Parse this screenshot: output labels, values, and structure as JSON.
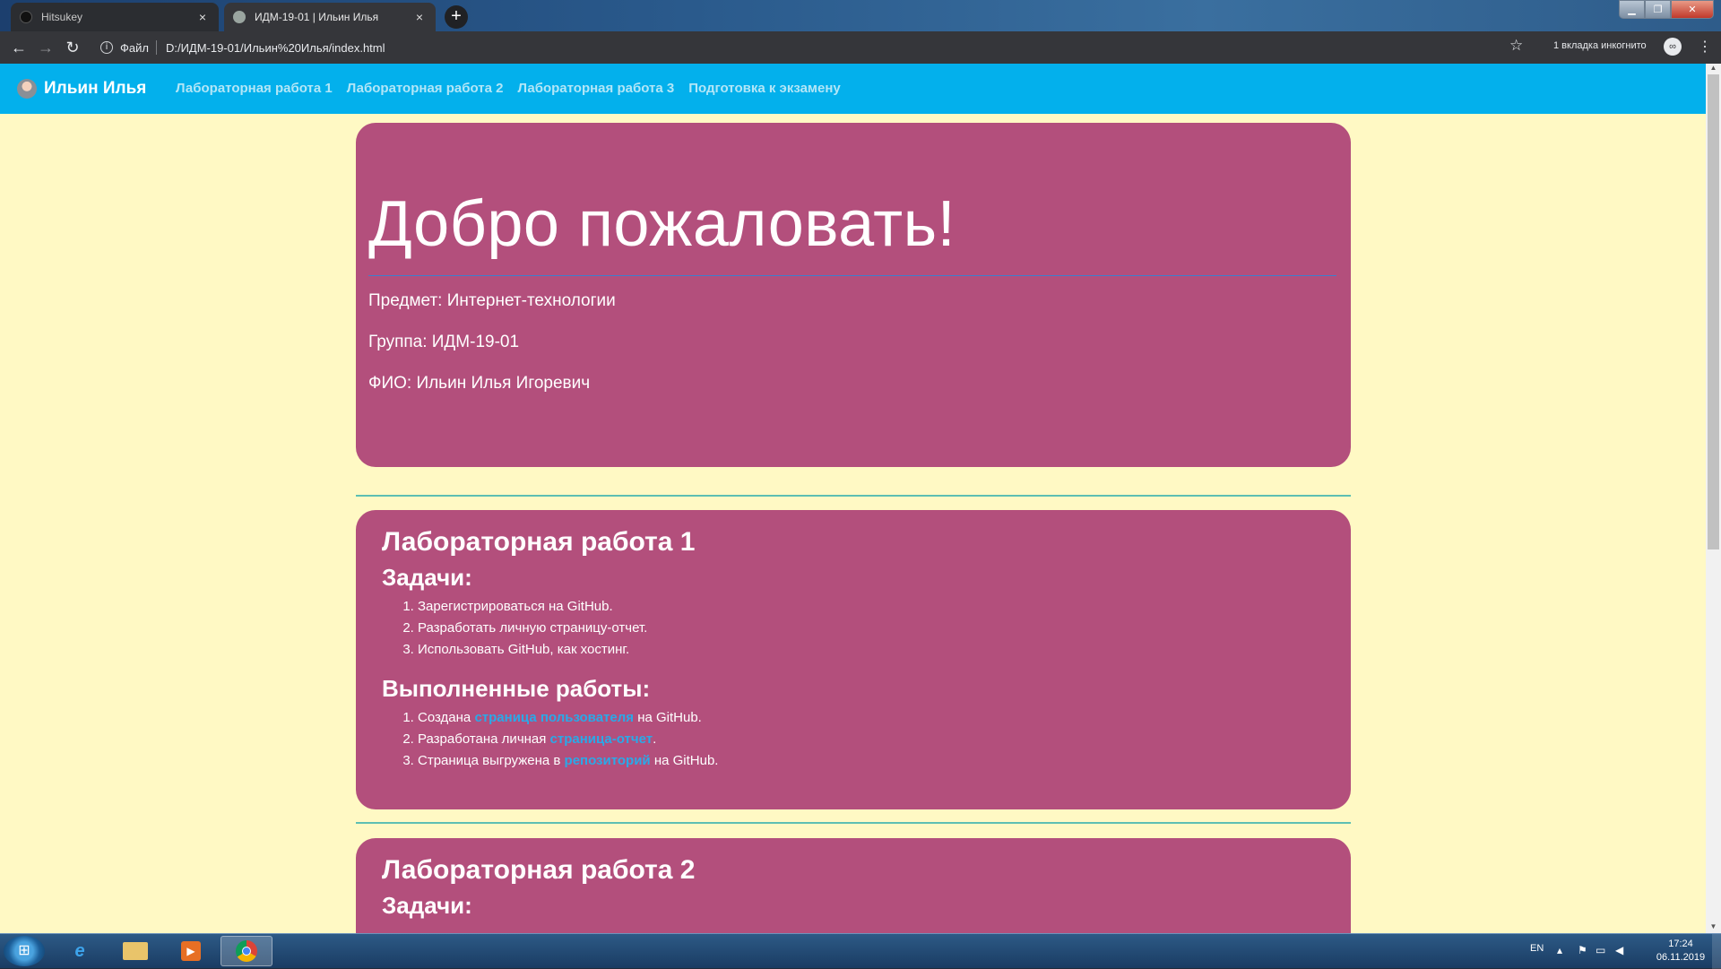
{
  "browser": {
    "tabs": [
      {
        "title": "Hitsukey",
        "active": false,
        "close": "×"
      },
      {
        "title": "ИДМ-19-01 | Ильин Илья",
        "active": true,
        "close": "×"
      }
    ],
    "new_tab": "+",
    "address": {
      "scheme": "Файл",
      "url": "D:/ИДМ-19-01/Ильин%20Илья/index.html"
    },
    "incognito_label": "1 вкладка инкогнито"
  },
  "page": {
    "navbar": {
      "brand": "Ильин Илья",
      "links": [
        "Лабораторная работа 1",
        "Лабораторная работа 2",
        "Лабораторная работа 3",
        "Подготовка к экзамену"
      ]
    },
    "hero": {
      "title": "Добро пожаловать!",
      "subject": "Предмет: Интернет-технологии",
      "group": "Группа: ИДМ-19-01",
      "name": "ФИО: Ильин Илья Игоревич"
    },
    "lab1": {
      "title": "Лабораторная работа 1",
      "tasks_heading": "Задачи:",
      "tasks": [
        "Зарегистрироваться на GitHub.",
        "Разработать личную страницу-отчет.",
        "Использовать GitHub, как хостинг."
      ],
      "done_heading": "Выполненные работы:",
      "done": [
        {
          "before": "Создана ",
          "link": "страница пользователя",
          "after": " на GitHub."
        },
        {
          "before": "Разработана личная ",
          "link": "страница-отчет",
          "after": "."
        },
        {
          "before": "Страница выгружена в ",
          "link": "репозиторий",
          "after": " на GitHub."
        }
      ]
    },
    "lab2": {
      "title": "Лабораторная работа 2",
      "tasks_heading": "Задачи:"
    },
    "colors": {
      "navbar": "#03b0ec",
      "card": "#b34f7c",
      "background": "#fff9c4",
      "link": "#2aa9e8"
    }
  },
  "taskbar": {
    "language": "EN",
    "time": "17:24",
    "date": "06.11.2019"
  }
}
